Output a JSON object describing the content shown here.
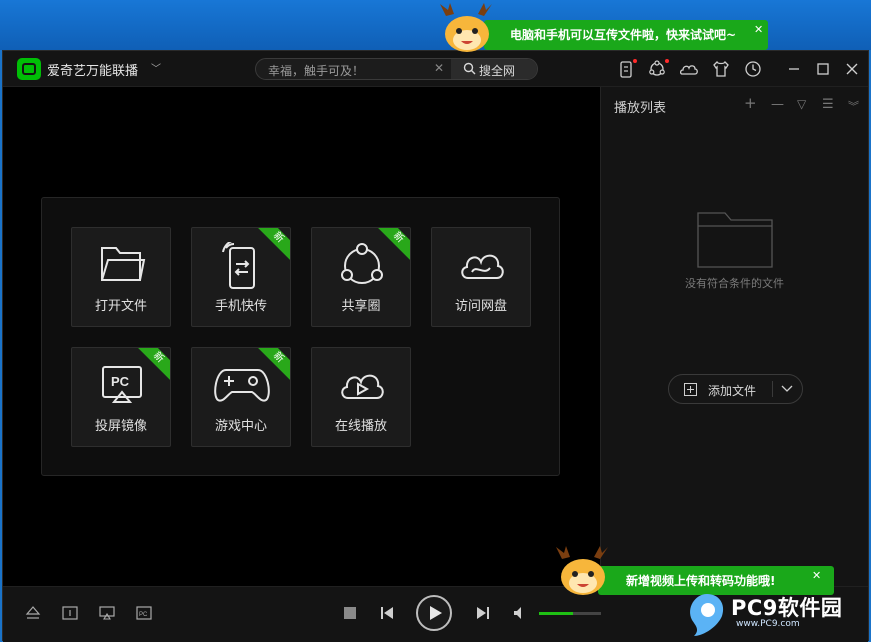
{
  "window": {
    "app_title": "爱奇艺万能联播",
    "search": {
      "placeholder": "幸福，触手可及！",
      "button_label": "搜全网"
    }
  },
  "home_grid": {
    "tiles": [
      {
        "label": "打开文件",
        "icon": "folder-icon",
        "badge": ""
      },
      {
        "label": "手机快传",
        "icon": "phone-transfer-icon",
        "badge": "新"
      },
      {
        "label": "共享圈",
        "icon": "share-circle-icon",
        "badge": "新"
      },
      {
        "label": "访问网盘",
        "icon": "cloud-drive-icon",
        "badge": ""
      },
      {
        "label": "投屏镜像",
        "icon": "screen-mirror-icon",
        "badge": "新",
        "icon_text": "PC"
      },
      {
        "label": "游戏中心",
        "icon": "gamepad-icon",
        "badge": "新"
      },
      {
        "label": "在线播放",
        "icon": "cloud-play-icon",
        "badge": ""
      }
    ]
  },
  "playlist": {
    "title": "播放列表",
    "empty_text": "没有符合条件的文件",
    "add_button_label": "添加文件"
  },
  "player": {
    "volume_level": 0.55,
    "mirror_icon_text": "PC"
  },
  "tips": {
    "top": "电脑和手机可以互传文件啦，快来试试吧~",
    "bottom": "新增视频上传和转码功能哦!"
  },
  "watermark": {
    "brand": "PC9软件园",
    "url": "www.PC9.com"
  },
  "colors": {
    "accent_green": "#1fc114",
    "bubble_green": "#1aa81a",
    "notification_red": "#ff2a2a",
    "background": "#000000"
  }
}
